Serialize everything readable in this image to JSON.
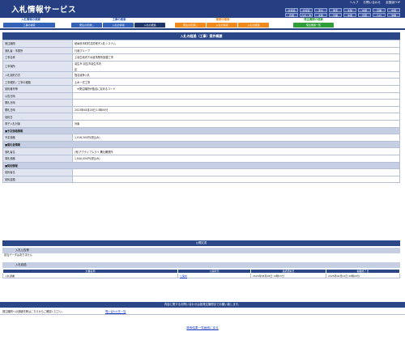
{
  "header": {
    "title": "入札情報サービス",
    "toplinks": [
      "ヘルプ",
      "お問い合わせ",
      "全国版TOP"
    ],
    "regions": [
      "北海道",
      "北海道",
      "東北",
      "関東",
      "北陸",
      "中部",
      "近畿",
      "中国",
      "四国",
      "九州・沖縄",
      "北陸",
      "近畿",
      "中国",
      "四国",
      "九州",
      "沖縄"
    ]
  },
  "tabs": {
    "group1": {
      "title": "入札情報の検索",
      "tabs": [
        "工事の検索"
      ]
    },
    "group2": {
      "title": "工事の検索",
      "tabs": [
        "発注の見通し",
        "入札の情報",
        "入札の経過"
      ]
    },
    "group3": {
      "title": "業務の検索",
      "tabs": [
        "発注の見通し",
        "入札の情報",
        "入札の経過"
      ]
    },
    "group4": {
      "title": "発注機関の検索",
      "tabs": [
        "発注機関一覧"
      ]
    }
  },
  "detail": {
    "section_title": "入札の経過（工事）案件概要",
    "rows": [
      {
        "label": "発注機関",
        "value": "岐阜県市町村共同電子入札システム"
      },
      {
        "label": "落札者・事業所",
        "value": "行政グループ"
      },
      {
        "label": "工事名称",
        "value": "上羽生地内下水道事業布設替工事"
      },
      {
        "label": "工事場所",
        "value": "羽生市 羽生市羽生市内"
      },
      {
        "label": "入札契約方式",
        "value": "指名競争入札"
      },
      {
        "label": "工事種別／工事の種類",
        "value": "土木一式工事"
      },
      {
        "label": "契約番号等",
        "value": "　※発注機関が独自に定めるコード"
      },
      {
        "label": "公告日時",
        "value": ""
      },
      {
        "label": "開札日時",
        "value": ""
      },
      {
        "label": "開札日時",
        "value": "2023年08月28日 13時00分"
      },
      {
        "label": "契約日",
        "value": ""
      },
      {
        "label": "電子入札対象",
        "value": "対象"
      }
    ],
    "sub1": "■予定価格情報",
    "price_rows": [
      {
        "label": "予定価格",
        "value": "1,916,200円(税込み)"
      }
    ],
    "sub2": "■落札者情報",
    "winner_rows": [
      {
        "label": "落札者名",
        "value": "(有)アクティブムライ 鷹社鷹業所"
      },
      {
        "label": "落札価格",
        "value": "1,640,000円(税込み)"
      }
    ],
    "sub3": "■契約情報",
    "contract_rows": [
      {
        "label": "契約者名",
        "value": ""
      },
      {
        "label": "契約金額",
        "value": ""
      }
    ],
    "location_extra": "区"
  },
  "kokai": {
    "title": "公開文書",
    "sub1": "入札公告等",
    "no_data": "該当データはありません",
    "sub2": "入札経過",
    "columns": [
      "文書名称",
      "公開状況",
      "最終更新日",
      "掲載終了日"
    ],
    "files": [
      {
        "name": "入札調書",
        "status": "公開中",
        "updated": "2023年08月28日 13時15分",
        "end": "2025年04月01日 00時00分"
      }
    ]
  },
  "footer": {
    "bar": "内容に関するお問い合わせは各発注機関までお願い致します。",
    "left": "発注機関への連絡先等はこちらからご確認ください。",
    "link": "問い合わせ先一覧",
    "back": "検索結果一覧画面に戻る"
  },
  "colors": {
    "navy": "#263f83",
    "tab_orange": "#f08a1c",
    "tab_green": "#2f9e3a",
    "tab_blue": "#3462b8"
  }
}
